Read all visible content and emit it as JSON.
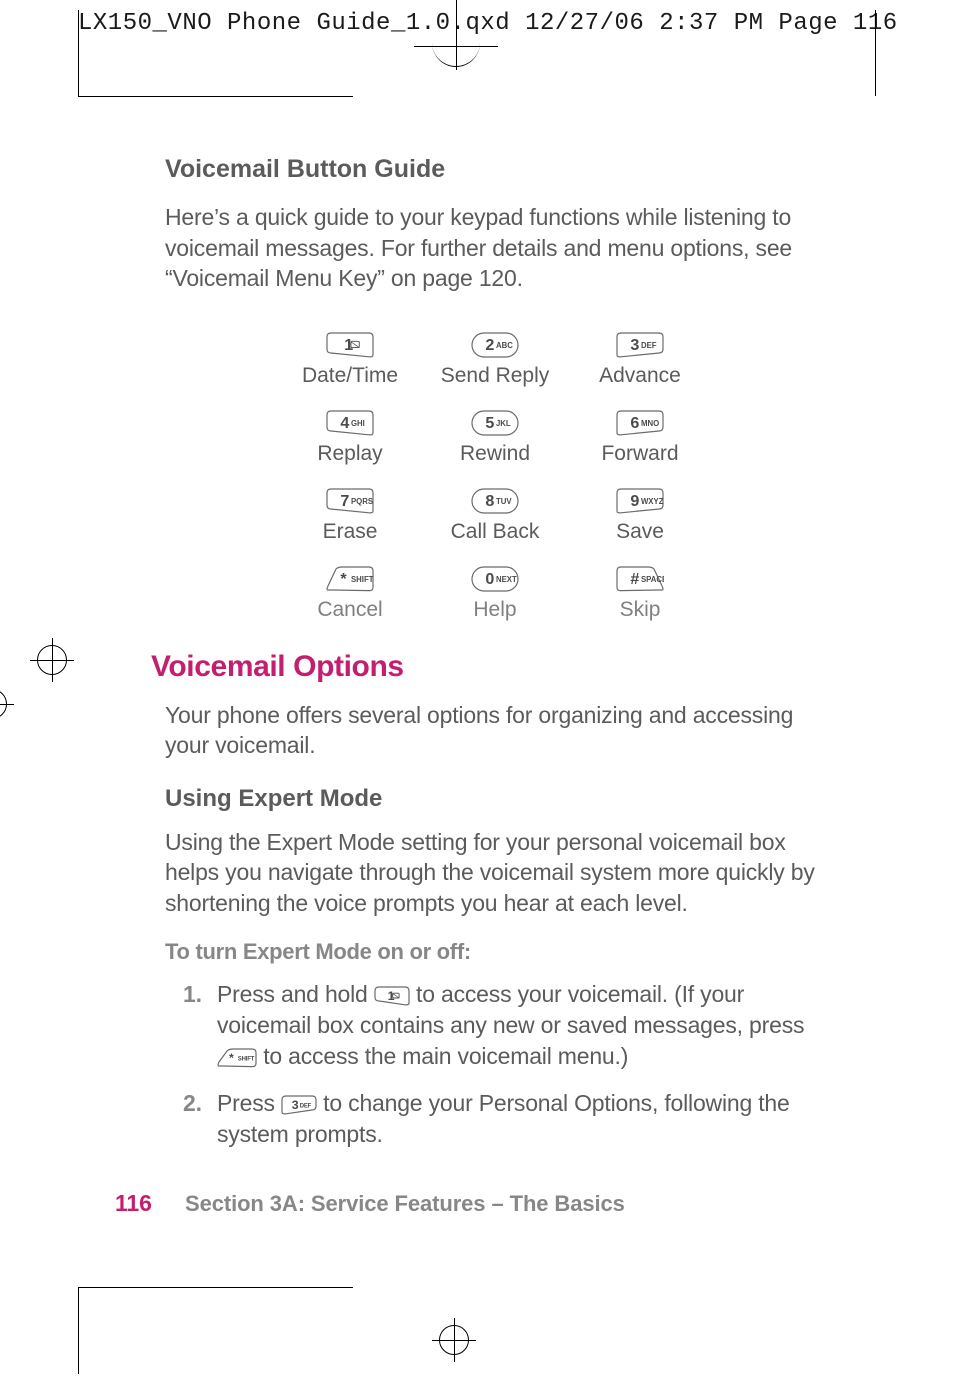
{
  "slug": "LX150_VNO Phone Guide_1.0.qxd  12/27/06  2:37 PM  Page 116",
  "buttonGuide": {
    "heading": "Voicemail Button Guide",
    "intro": "Here’s a quick guide to your keypad functions while listening to voicemail messages. For further details and menu options, see “Voicemail Menu Key” on page 120.",
    "keys": [
      [
        {
          "cap": "1",
          "sub": "",
          "label": "Date/Time",
          "shape": "rect-left"
        },
        {
          "cap": "2",
          "sub": "ABC",
          "label": "Send Reply",
          "shape": "pill"
        },
        {
          "cap": "3",
          "sub": "DEF",
          "label": "Advance",
          "shape": "rect-right"
        }
      ],
      [
        {
          "cap": "4",
          "sub": "GHI",
          "label": "Replay",
          "shape": "rect-left"
        },
        {
          "cap": "5",
          "sub": "JKL",
          "label": "Rewind",
          "shape": "pill"
        },
        {
          "cap": "6",
          "sub": "MNO",
          "label": "Forward",
          "shape": "rect-right"
        }
      ],
      [
        {
          "cap": "7",
          "sub": "PQRS",
          "label": "Erase",
          "shape": "rect-left"
        },
        {
          "cap": "8",
          "sub": "TUV",
          "label": "Call Back",
          "shape": "pill"
        },
        {
          "cap": "9",
          "sub": "WXYZ",
          "label": "Save",
          "shape": "rect-right"
        }
      ],
      [
        {
          "cap": "*",
          "sub": "SHIFT",
          "label": "Cancel",
          "shape": "trap-left"
        },
        {
          "cap": "0",
          "sub": "NEXT",
          "label": "Help",
          "shape": "pill"
        },
        {
          "cap": "#",
          "sub": "SPACE",
          "label": "Skip",
          "shape": "trap-right"
        }
      ]
    ]
  },
  "options": {
    "heading": "Voicemail Options",
    "intro": "Your phone offers several options for organizing and accessing your voicemail."
  },
  "expert": {
    "heading": "Using Expert Mode",
    "intro": "Using the Expert Mode setting for your personal voicemail box helps you navigate through the voicemail system more quickly by shortening the voice prompts you hear at each level.",
    "sub": "To turn Expert Mode on or off:",
    "steps": [
      {
        "num": "1.",
        "pre": "Press and hold ",
        "key": {
          "cap": "1",
          "sub": "",
          "shape": "rect-left"
        },
        "mid": " to access your voicemail. (If your voicemail box contains any new or saved messages, press ",
        "key2": {
          "cap": "*",
          "sub": "SHIFT",
          "shape": "trap-left"
        },
        "post": " to access the main voicemail menu.)"
      },
      {
        "num": "2.",
        "pre": "Press ",
        "key": {
          "cap": "3",
          "sub": "DEF",
          "shape": "rect-right"
        },
        "mid": " to change your Personal Options, following the system prompts.",
        "key2": null,
        "post": ""
      }
    ]
  },
  "footer": {
    "page": "116",
    "section": "Section 3A: Service Features – The Basics"
  }
}
